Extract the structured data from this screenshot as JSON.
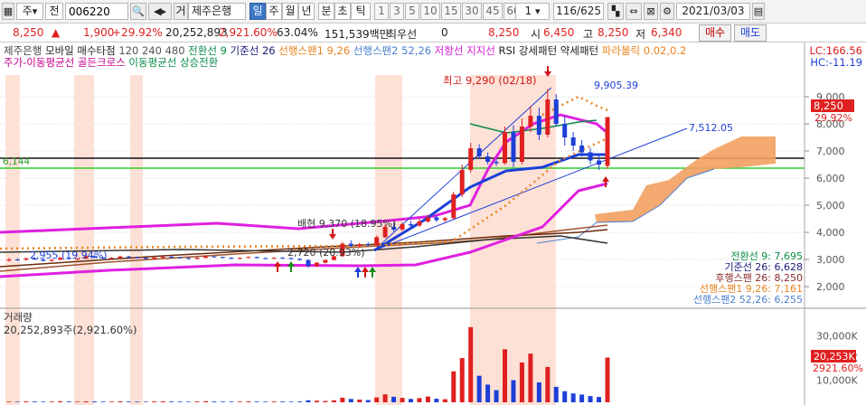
{
  "toolbar": {
    "market": "주",
    "jeon": "전",
    "code": "006220",
    "geo": "거",
    "stock_name": "제주은행",
    "periods": [
      "일",
      "주",
      "월",
      "년",
      "분",
      "초",
      "틱"
    ],
    "selected_period": "일",
    "intervals": [
      "1",
      "3",
      "5",
      "10",
      "15",
      "30",
      "45",
      "60"
    ],
    "interval_value": "1",
    "count_value": "116",
    "count_total": "/625",
    "date": "2021/03/03"
  },
  "price_bar": {
    "current": "8,250",
    "change": "1,900",
    "change_pct": "+29.92%",
    "volume": "20,252,893",
    "volume_pct": "2,921.60%",
    "turnover_pct": "63.04%",
    "amount": "151,539백만",
    "priority_label": "최우선",
    "priority_value": "0",
    "open_price": "8,250",
    "open_label": "시",
    "open_value": "6,450",
    "high_label": "고",
    "high_value": "8,250",
    "low_label": "저",
    "low_value": "6,340",
    "buy_label": "매수",
    "sell_label": "매도"
  },
  "legend": {
    "line1": [
      {
        "text": "제주은행",
        "color": "#444444"
      },
      {
        "text": "모바일 매수타점",
        "color": "#222222"
      },
      {
        "text": "120",
        "color": "#555555"
      },
      {
        "text": "240",
        "color": "#555555"
      },
      {
        "text": "480",
        "color": "#555555"
      },
      {
        "text": "전환선 9",
        "color": "#0b8a48"
      },
      {
        "text": "기준선 26",
        "color": "#1a1a7a"
      },
      {
        "text": "선행스팬1 9,26",
        "color": "#e88420"
      },
      {
        "text": "선행스팬2 52,26",
        "color": "#4a7fcf"
      },
      {
        "text": "저항선",
        "color": "#d81ad8"
      },
      {
        "text": "지지선",
        "color": "#d81ad8"
      },
      {
        "text": "RSI 강세패턴",
        "color": "#222222"
      },
      {
        "text": "약세패턴",
        "color": "#222222"
      },
      {
        "text": "파라볼릭 0.02,0.2",
        "color": "#e88420"
      }
    ],
    "line2": [
      {
        "text": "주가-이동평균선 골든크로스",
        "color": "#c3008c"
      },
      {
        "text": "이동평균선 상승전환",
        "color": "#0b8a48"
      }
    ],
    "lc": "LC:166.56",
    "hc": "HC:-11.19"
  },
  "chart_data": {
    "type": "candlestick",
    "y_axis": {
      "min": 1500,
      "max": 9500,
      "ticks": [
        "9,000",
        "8,000",
        "7,000",
        "6,000",
        "5,000",
        "4,000",
        "3,000",
        "2,000"
      ]
    },
    "price_tag": {
      "value": "8,250",
      "pct": "29.92%"
    },
    "left_value_label": "6,144",
    "annotations": {
      "high": "최고 9,290 (02/18)",
      "trend_top": "9,905.39",
      "trend_right": "7,512.05",
      "left1": "배현 9,370 (18.95%)",
      "left2": "2,720 (20.93%)",
      "left3": "2,955 (19.94%)"
    },
    "indicator_values": [
      {
        "text": "전환선 9: 7,695",
        "color": "#0b8a48"
      },
      {
        "text": "기준선 26: 6,628",
        "color": "#1a1a7a"
      },
      {
        "text": "후행스팬 26: 8,250",
        "color": "#8a2a2a"
      },
      {
        "text": "선행스팬1 9,26: 7,161",
        "color": "#e88420"
      },
      {
        "text": "선행스팬2 52,26: 6,255",
        "color": "#4a7fcf"
      }
    ],
    "volume_panel": {
      "title": "거래량",
      "summary": "20,252,893주(2,921.60%)",
      "ticks": [
        "30,000K",
        "20,000K",
        "10,000K"
      ],
      "tag_value": "20,253K",
      "tag_pct": "2921.60%"
    },
    "candles": [
      [
        2960,
        3060,
        2920,
        3000
      ],
      [
        3000,
        3040,
        2950,
        2990
      ],
      [
        2990,
        3070,
        2960,
        3040
      ],
      [
        3040,
        3080,
        2990,
        3000
      ],
      [
        3000,
        3020,
        2930,
        2950
      ],
      [
        2950,
        3010,
        2920,
        2990
      ],
      [
        2990,
        3100,
        2970,
        3060
      ],
      [
        3060,
        3090,
        3000,
        3020
      ],
      [
        3020,
        3050,
        2980,
        3030
      ],
      [
        3030,
        3150,
        3010,
        3120
      ],
      [
        3120,
        3150,
        3050,
        3070
      ],
      [
        3070,
        3090,
        3020,
        3050
      ],
      [
        3050,
        3080,
        3010,
        3060
      ],
      [
        3060,
        3140,
        3040,
        3110
      ],
      [
        3110,
        3130,
        3060,
        3080
      ],
      [
        3080,
        3110,
        3040,
        3060
      ],
      [
        3060,
        3070,
        3000,
        3020
      ],
      [
        3020,
        3090,
        3000,
        3070
      ],
      [
        3070,
        3120,
        3050,
        3100
      ],
      [
        3100,
        3130,
        3060,
        3080
      ],
      [
        3080,
        3100,
        3030,
        3050
      ],
      [
        3050,
        3070,
        3000,
        3020
      ],
      [
        3020,
        3080,
        3000,
        3060
      ],
      [
        3060,
        3140,
        3040,
        3110
      ],
      [
        3110,
        3130,
        3070,
        3090
      ],
      [
        3090,
        3100,
        3040,
        3060
      ],
      [
        3060,
        3080,
        3020,
        3040
      ],
      [
        3040,
        3070,
        3000,
        3060
      ],
      [
        3060,
        3110,
        3040,
        3090
      ],
      [
        3090,
        3100,
        3040,
        3050
      ],
      [
        3050,
        3070,
        3010,
        3030
      ],
      [
        3030,
        3080,
        3010,
        3060
      ],
      [
        3060,
        3090,
        3030,
        3050
      ],
      [
        3050,
        3070,
        3000,
        3020
      ],
      [
        3020,
        3040,
        2960,
        2980
      ],
      [
        2980,
        3010,
        2700,
        2760
      ],
      [
        2760,
        2900,
        2720,
        2880
      ],
      [
        2880,
        3000,
        2850,
        2980
      ],
      [
        2980,
        3150,
        2960,
        3120
      ],
      [
        3120,
        3650,
        3100,
        3580
      ],
      [
        3580,
        3700,
        3450,
        3500
      ],
      [
        3500,
        3620,
        3420,
        3560
      ],
      [
        3560,
        3640,
        3480,
        3520
      ],
      [
        3520,
        3880,
        3500,
        3820
      ],
      [
        3820,
        4300,
        3780,
        4200
      ],
      [
        4200,
        4360,
        4020,
        4100
      ],
      [
        4100,
        4380,
        4050,
        4300
      ],
      [
        4300,
        4420,
        4150,
        4250
      ],
      [
        4250,
        4500,
        4200,
        4400
      ],
      [
        4400,
        4650,
        4350,
        4550
      ],
      [
        4550,
        4620,
        4380,
        4450
      ],
      [
        4450,
        4580,
        4380,
        4520
      ],
      [
        4520,
        5500,
        4480,
        5400
      ],
      [
        5400,
        6500,
        5300,
        6300
      ],
      [
        6300,
        7300,
        6200,
        7100
      ],
      [
        7100,
        7250,
        6700,
        6800
      ],
      [
        6800,
        6950,
        6500,
        6600
      ],
      [
        6600,
        6700,
        6450,
        6550
      ],
      [
        6550,
        7900,
        6500,
        7700
      ],
      [
        7700,
        7950,
        6400,
        6600
      ],
      [
        6600,
        8200,
        6500,
        7900
      ],
      [
        7900,
        8650,
        7700,
        8300
      ],
      [
        8300,
        8600,
        7400,
        7600
      ],
      [
        7600,
        9290,
        7500,
        8900
      ],
      [
        8900,
        9100,
        7900,
        8000
      ],
      [
        8000,
        8300,
        7200,
        7500
      ],
      [
        7500,
        7700,
        7000,
        7200
      ],
      [
        7200,
        7400,
        6800,
        6950
      ],
      [
        6950,
        7100,
        6500,
        6650
      ],
      [
        6650,
        6900,
        6300,
        6500
      ],
      [
        6450,
        8250,
        6340,
        8250
      ]
    ],
    "volumes": [
      300,
      250,
      400,
      350,
      280,
      320,
      500,
      360,
      300,
      420,
      380,
      300,
      310,
      450,
      330,
      290,
      260,
      380,
      410,
      330,
      300,
      280,
      360,
      480,
      350,
      300,
      290,
      320,
      400,
      310,
      290,
      340,
      330,
      280,
      350,
      900,
      700,
      600,
      900,
      2100,
      1500,
      1200,
      1000,
      2200,
      3600,
      2500,
      2000,
      1500,
      1900,
      2600,
      1600,
      1400,
      14000,
      20000,
      34000,
      12000,
      8000,
      5500,
      24000,
      10000,
      18000,
      22000,
      9000,
      16000,
      7000,
      5000,
      4000,
      3500,
      2800,
      2400,
      20253
    ]
  }
}
